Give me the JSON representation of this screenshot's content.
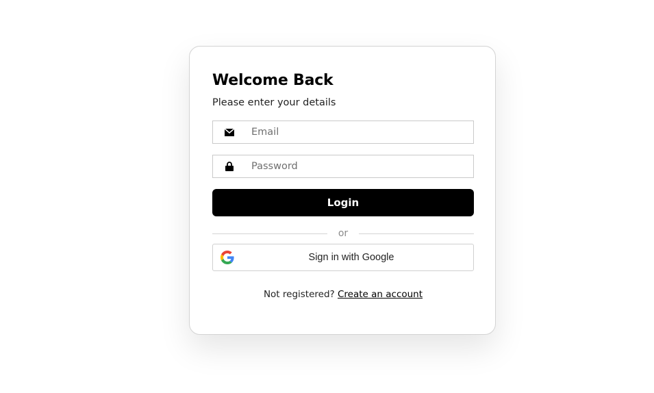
{
  "login_card": {
    "title": "Welcome Back",
    "subtitle": "Please enter your details",
    "email": {
      "value": "",
      "placeholder": "Email",
      "icon": "envelope-icon"
    },
    "password": {
      "value": "",
      "placeholder": "Password",
      "icon": "lock-icon"
    },
    "login_label": "Login",
    "divider_text": "or",
    "google": {
      "label": "Sign in with Google",
      "icon": "google-icon"
    },
    "footer": {
      "prompt": "Not registered?",
      "link_text": "Create an account"
    }
  },
  "colors": {
    "primary_button": "#000000",
    "primary_button_text": "#ffffff",
    "card_border": "#d3d3d3",
    "input_border": "#c9c9c9",
    "divider": "#d4d4d4",
    "google_blue": "#4285F4",
    "google_red": "#EA4335",
    "google_yellow": "#FBBC05",
    "google_green": "#34A853"
  }
}
